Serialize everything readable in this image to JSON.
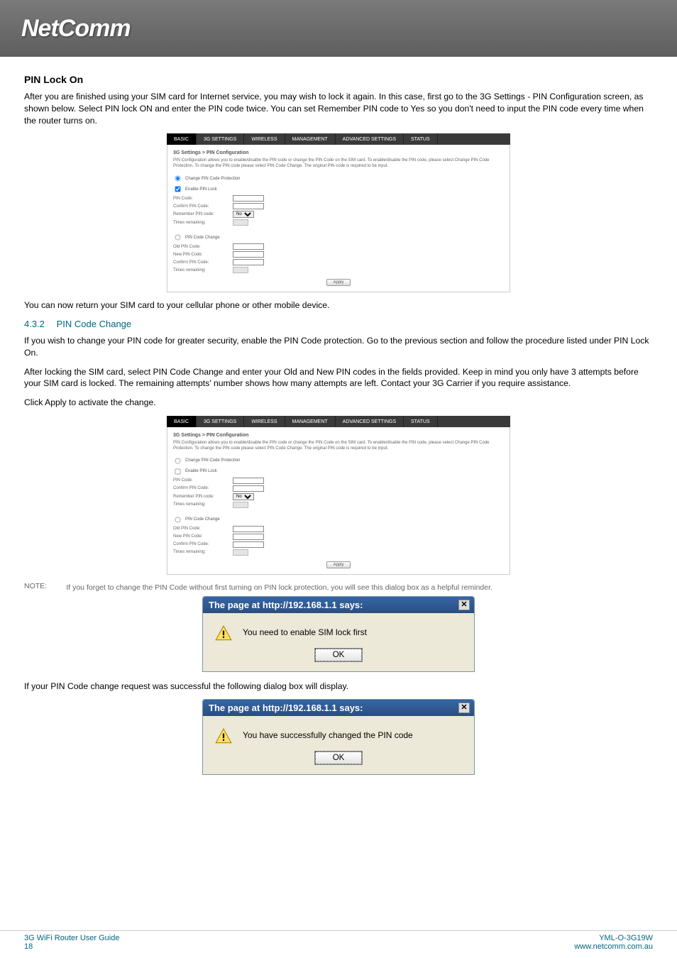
{
  "logo_text": "NetComm",
  "section1_title": "PIN Lock On",
  "section1_para": "After you are finished using your SIM card for Internet service, you may wish to lock it again. In this case, first go to the 3G Settings - PIN Configuration screen, as shown below. Select PIN lock ON and enter the PIN code twice. You can set Remember PIN code to Yes so you don't need to input the PIN code every time when the router turns on.",
  "after_panel1": "You can now return your SIM card to your cellular phone or other mobile device.",
  "sub_num": "4.3.2",
  "sub_title": "PIN Code Change",
  "sub_para1": "If you wish to change your PIN code for greater security, enable the PIN Code protection. Go to the previous section and follow the procedure listed under PIN Lock On.",
  "sub_para2": "After locking the SIM card, select PIN Code Change and enter your Old and New PIN codes in the fields provided. Keep in mind you only have 3 attempts before your SIM card is locked. The remaining attempts' number shows how many attempts are left. Contact your 3G Carrier if you require assistance.",
  "sub_para3": "Click Apply to activate the change.",
  "note_label": "NOTE:",
  "note_text": "If you forget to change the PIN Code without first turning on PIN lock protection, you will see this dialog box as a helpful reminder.",
  "success_text": "If your PIN Code change request was successful the following dialog box will display.",
  "panel_nav": {
    "basic": "BASIC",
    "threeg": "3G SETTINGS",
    "wireless": "WIRELESS",
    "management": "MANAGEMENT",
    "adv": "ADVANCED SETTINGS",
    "status": "STATUS"
  },
  "panel": {
    "breadcrumb": "3G Settings > PIN Configuration",
    "desc": "PIN Configuration allows you to enable/disable the PIN code or change the PIN Code on the SIM card.\nTo enable/disable the PIN code, please select Change PIN Code Protection. To change the PIN code please select PIN Code Change.\nThe original PIN code is required to be input.",
    "radio_protect": "Change PIN Code Protection",
    "chk_enable": "Enable PIN Lock",
    "pin_code": "PIN Code:",
    "confirm_pin": "Confirm PIN Code:",
    "remember": "Remember PIN code:",
    "remember_opt": "No",
    "times": "Times remaining:",
    "radio_change": "PIN Code Change",
    "old_pin": "Old PIN Code:",
    "new_pin": "New PIN Code:",
    "confirm_pin2": "Confirm PIN Code:",
    "apply": "Apply"
  },
  "dialog": {
    "title": "The page at http://192.168.1.1 says:",
    "msg1": "You need to enable SIM lock first",
    "msg2": "You have successfully changed the PIN code",
    "ok": "OK"
  },
  "footer": {
    "guide": "3G WiFi Router User Guide",
    "page": "18",
    "code": "YML-O-3G19W",
    "url": "www.netcomm.com.au"
  }
}
